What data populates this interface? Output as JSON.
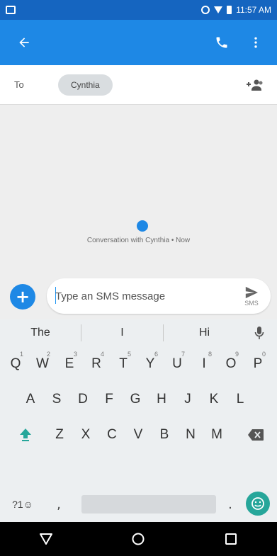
{
  "status_bar": {
    "time": "11:57 AM"
  },
  "to_row": {
    "label": "To",
    "recipient": "Cynthia"
  },
  "conversation": {
    "info": "Conversation with Cynthia • Now"
  },
  "compose": {
    "placeholder": "Type an SMS message",
    "send_sub": "SMS"
  },
  "keyboard": {
    "suggestions": [
      "The",
      "I",
      "Hi"
    ],
    "row1": [
      {
        "k": "Q",
        "h": "1"
      },
      {
        "k": "W",
        "h": "2"
      },
      {
        "k": "E",
        "h": "3"
      },
      {
        "k": "R",
        "h": "4"
      },
      {
        "k": "T",
        "h": "5"
      },
      {
        "k": "Y",
        "h": "6"
      },
      {
        "k": "U",
        "h": "7"
      },
      {
        "k": "I",
        "h": "8"
      },
      {
        "k": "O",
        "h": "9"
      },
      {
        "k": "P",
        "h": "0"
      }
    ],
    "row2": [
      "A",
      "S",
      "D",
      "F",
      "G",
      "H",
      "J",
      "K",
      "L"
    ],
    "row3": [
      "Z",
      "X",
      "C",
      "V",
      "B",
      "N",
      "M"
    ],
    "sym_label": "?1☺",
    "comma": ",",
    "period": "."
  },
  "colors": {
    "accent": "#1e88e5",
    "status_bar": "#1565c0",
    "emoji_key": "#26a69a"
  }
}
